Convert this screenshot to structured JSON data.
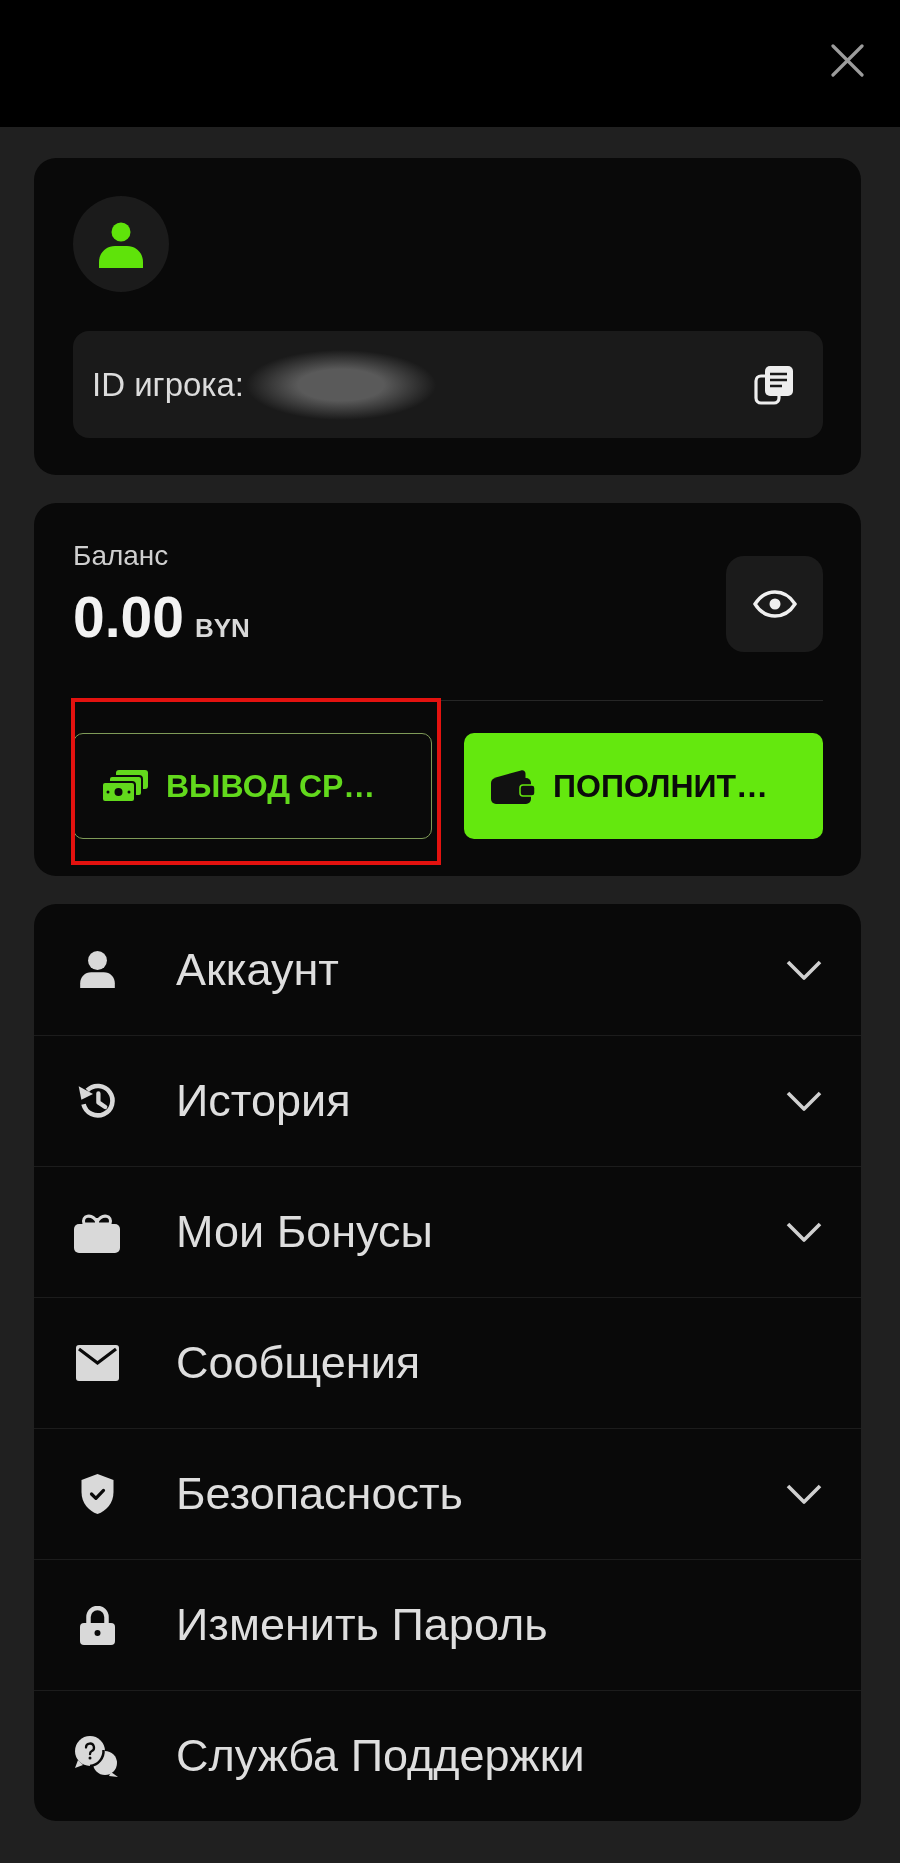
{
  "profile": {
    "player_id": {
      "label": "ID игрока:",
      "value_blurred": true
    }
  },
  "balance": {
    "label": "Баланс",
    "amount": "0.00",
    "currency": "BYN",
    "buttons": [
      {
        "kind": "withdraw",
        "label": "ВЫВОД СР…",
        "highlighted": true
      },
      {
        "kind": "deposit",
        "label": "ПОПОЛНИТ…",
        "highlighted": false
      }
    ]
  },
  "menu": [
    {
      "kind": "account",
      "label": "Аккаунт",
      "expandable": true
    },
    {
      "kind": "history",
      "label": "История",
      "expandable": true
    },
    {
      "kind": "bonuses",
      "label": "Мои Бонусы",
      "expandable": true
    },
    {
      "kind": "messages",
      "label": "Сообщения",
      "expandable": false
    },
    {
      "kind": "security",
      "label": "Безопасность",
      "expandable": true
    },
    {
      "kind": "password",
      "label": "Изменить Пароль",
      "expandable": false
    },
    {
      "kind": "support",
      "label": "Служба Поддержки",
      "expandable": false
    }
  ]
}
